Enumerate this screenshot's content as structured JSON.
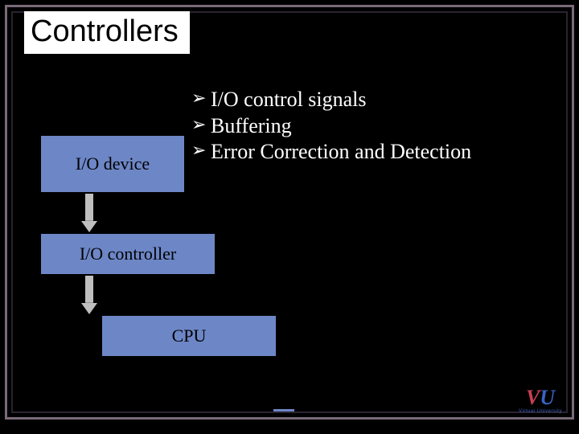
{
  "title": "Controllers",
  "diagram": {
    "nodes": {
      "io_device": "I/O device",
      "io_controller": "I/O controller",
      "cpu": "CPU"
    }
  },
  "bullets": [
    "I/O control signals",
    "Buffering",
    "Error Correction and Detection"
  ],
  "logo": {
    "v": "V",
    "u": "U",
    "sub": "Virtual University"
  }
}
